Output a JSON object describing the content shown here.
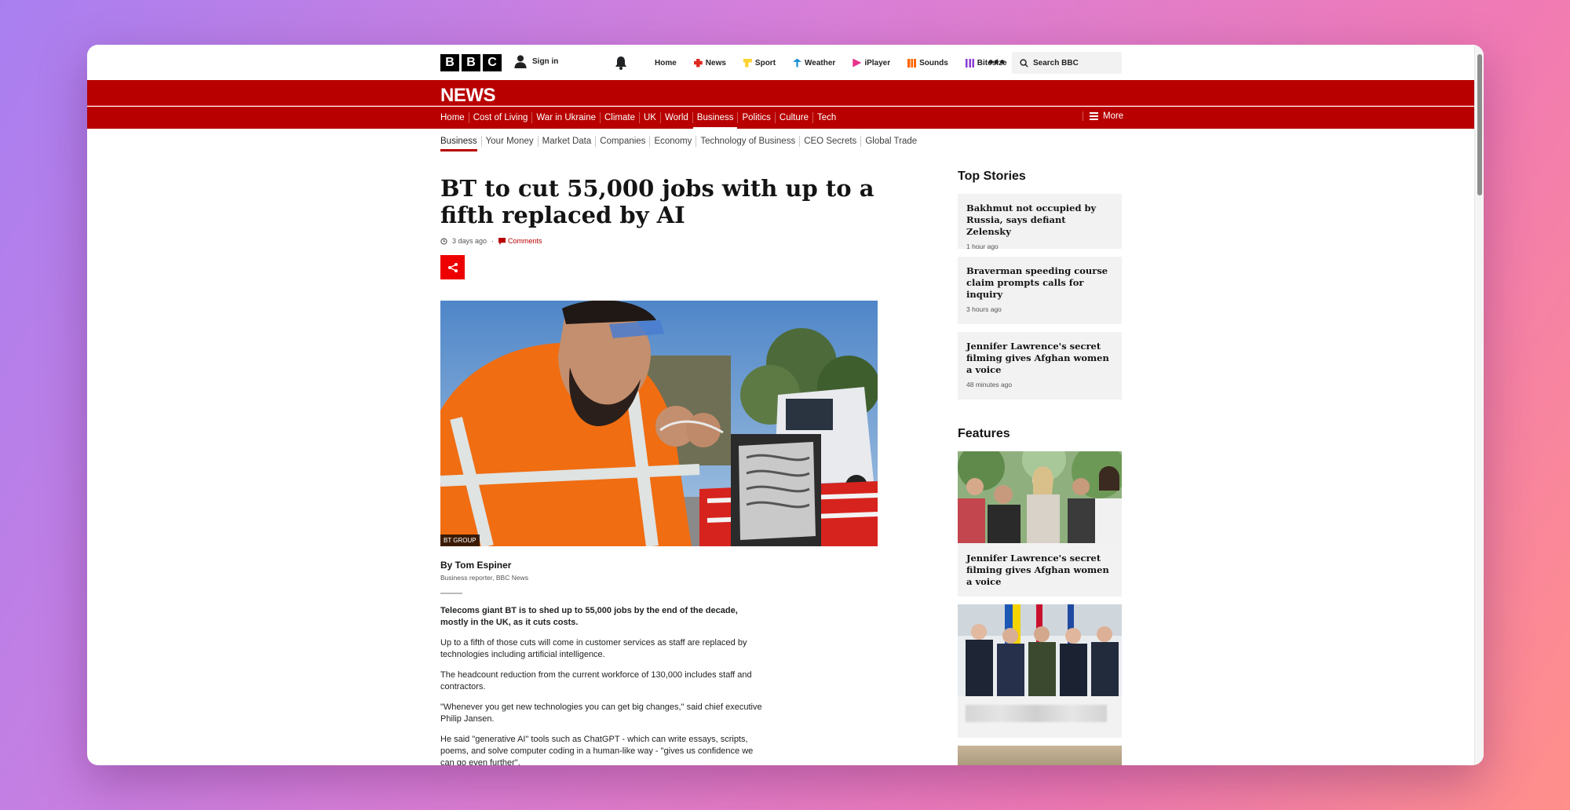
{
  "masthead": {
    "logo_letters": [
      "B",
      "B",
      "C"
    ],
    "signin_label": "Sign in",
    "nav": [
      {
        "label": "Home",
        "icon": "none",
        "color": ""
      },
      {
        "label": "News",
        "icon": "news-icon",
        "color": "#e0281f"
      },
      {
        "label": "Sport",
        "icon": "sport-icon",
        "color": "#ffd230"
      },
      {
        "label": "Weather",
        "icon": "weather-icon",
        "color": "#1a8fd6"
      },
      {
        "label": "iPlayer",
        "icon": "iplayer-icon",
        "color": "#e8318a"
      },
      {
        "label": "Sounds",
        "icon": "sounds-icon",
        "color": "#ff6600"
      },
      {
        "label": "Bitesize",
        "icon": "bitesize-icon",
        "color": "#8a3bd1"
      }
    ],
    "more_label": "•••",
    "search_placeholder": "Search BBC"
  },
  "news_bar": {
    "wordmark": "NEWS",
    "sections": [
      "Home",
      "Cost of Living",
      "War in Ukraine",
      "Climate",
      "UK",
      "World",
      "Business",
      "Politics",
      "Culture",
      "Tech"
    ],
    "active_section": "Business",
    "more_label": "More"
  },
  "subnav": [
    "Business",
    "Your Money",
    "Market Data",
    "Companies",
    "Economy",
    "Technology of Business",
    "CEO Secrets",
    "Global Trade"
  ],
  "article": {
    "headline": "BT to cut 55,000 jobs with up to a fifth replaced by AI",
    "timestamp": "3 days ago",
    "comments_label": "Comments",
    "image_credit": "BT GROUP",
    "author": "By Tom Espiner",
    "author_role": "Business reporter, BBC News",
    "paragraphs": [
      "Telecoms giant BT is to shed up to 55,000 jobs by the end of the decade, mostly in the UK, as it cuts costs.",
      "Up to a fifth of those cuts will come in customer services as staff are replaced by technologies including artificial intelligence.",
      "The headcount reduction from the current workforce of 130,000 includes staff and contractors.",
      "\"Whenever you get new technologies you can get big changes,\" said chief executive Philip Jansen.",
      "He said \"generative AI\" tools such as ChatGPT - which can write essays, scripts, poems, and solve computer coding in a human-like way - \"gives us confidence we can go even further\"."
    ]
  },
  "sidebar": {
    "top_stories_heading": "Top Stories",
    "top_stories": [
      {
        "title": "Bakhmut not occupied by Russia, says defiant Zelensky",
        "ago": "1 hour ago"
      },
      {
        "title": "Braverman speeding course claim prompts calls for inquiry",
        "ago": "3 hours ago"
      },
      {
        "title": "Jennifer Lawrence's secret filming gives Afghan women a voice",
        "ago": "48 minutes ago"
      }
    ],
    "features_heading": "Features",
    "features": [
      {
        "title": "Jennifer Lawrence's secret filming gives Afghan women a voice"
      },
      {
        "title": ""
      }
    ]
  },
  "colors": {
    "bbc_red": "#b80000",
    "share_red": "#e00000"
  }
}
